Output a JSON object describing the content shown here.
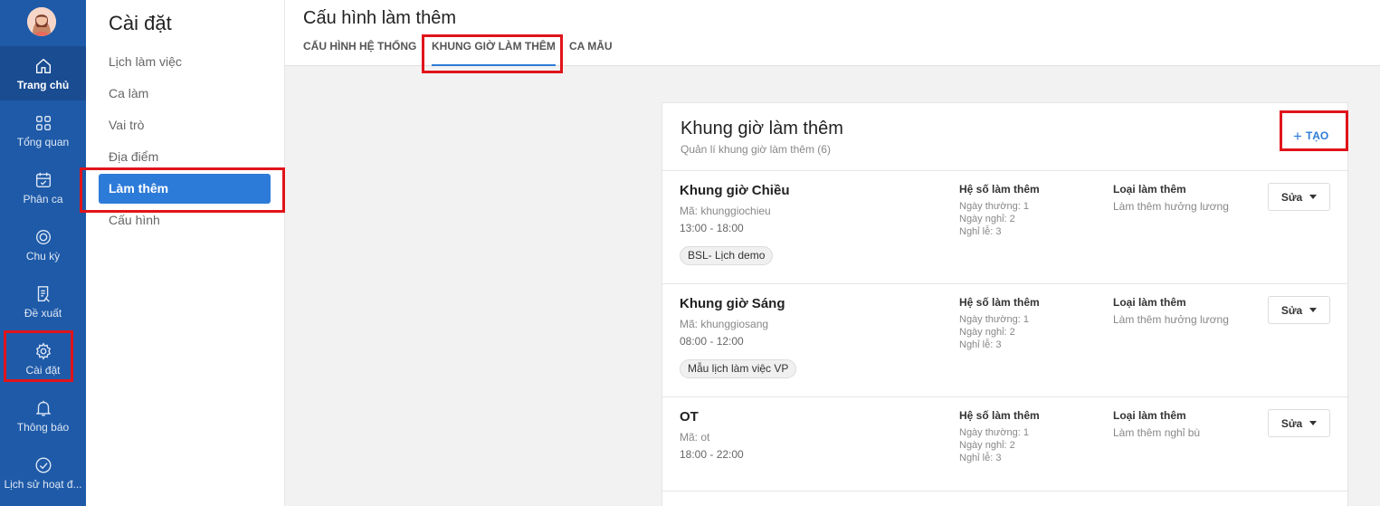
{
  "nav": {
    "items": [
      {
        "label": "Trang chủ",
        "icon": "home-icon"
      },
      {
        "label": "Tổng quan",
        "icon": "grid-icon"
      },
      {
        "label": "Phân ca",
        "icon": "calendar-icon"
      },
      {
        "label": "Chu kỳ",
        "icon": "cycle-icon"
      },
      {
        "label": "Đề xuất",
        "icon": "document-icon"
      },
      {
        "label": "Cài đặt",
        "icon": "gear-icon"
      },
      {
        "label": "Thông báo",
        "icon": "bell-icon"
      },
      {
        "label": "Lịch sử hoạt đ...",
        "icon": "check-circle-icon"
      }
    ]
  },
  "settings": {
    "title": "Cài đặt",
    "items": [
      "Lịch làm việc",
      "Ca làm",
      "Vai trò",
      "Địa điểm",
      "Làm thêm",
      "Cấu hình"
    ]
  },
  "header": {
    "title": "Cấu hình làm thêm",
    "tabs": [
      "CẤU HÌNH HỆ THỐNG",
      "KHUNG GIỜ LÀM THÊM",
      "CA MẪU"
    ]
  },
  "card": {
    "title": "Khung giờ làm thêm",
    "subtitle": "Quản lí khung giờ làm thêm (6)",
    "create_label": "TẠO",
    "coef_header": "Hệ số làm thêm",
    "type_header": "Loại làm thêm",
    "edit_label": "Sửa",
    "rows": [
      {
        "name": "Khung giờ Chiều",
        "code": "Mã: khunggiochieu",
        "time": "13:00 - 18:00",
        "tag": "BSL- Lịch demo",
        "weekday": "Ngày thường: 1",
        "dayoff": "Ngày nghỉ: 2",
        "holiday": "Nghỉ lễ: 3",
        "type": "Làm thêm hưởng lương"
      },
      {
        "name": "Khung giờ Sáng",
        "code": "Mã: khunggiosang",
        "time": "08:00 - 12:00",
        "tag": "Mẫu lịch làm việc VP",
        "weekday": "Ngày thường: 1",
        "dayoff": "Ngày nghỉ: 2",
        "holiday": "Nghỉ lễ: 3",
        "type": "Làm thêm hưởng lương"
      },
      {
        "name": "OT",
        "code": "Mã: ot",
        "time": "18:00 - 22:00",
        "tag": "",
        "weekday": "Ngày thường: 1",
        "dayoff": "Ngày nghỉ: 2",
        "holiday": "Nghỉ lễ: 3",
        "type": "Làm thêm nghỉ bù"
      }
    ]
  },
  "colors": {
    "rail": "#1e5aa8",
    "accent": "#2d7bd9",
    "highlight": "#e0141a"
  }
}
